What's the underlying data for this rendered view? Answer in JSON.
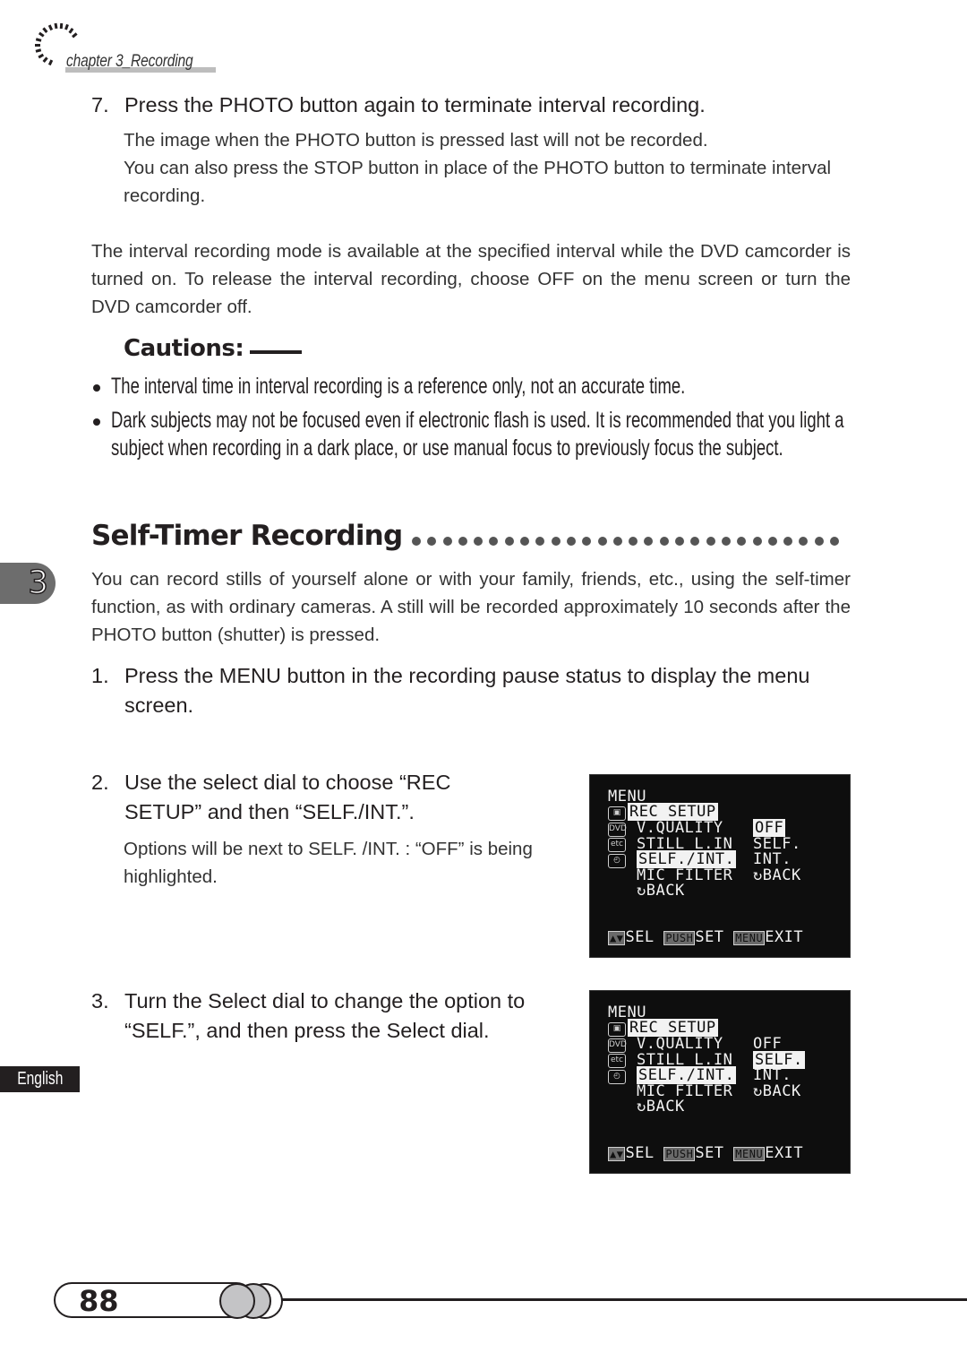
{
  "header": {
    "chapter_label": "chapter 3_Recording"
  },
  "step7": {
    "number": "7.",
    "heading": "Press the PHOTO button again to terminate interval recording.",
    "lines": [
      "The image when the PHOTO button is pressed last will not be recorded.",
      "You can also press the STOP button in place of the PHOTO button to terminate interval recording."
    ]
  },
  "interval_note": "The interval recording mode is available at the specified interval while the DVD camcorder is turned on. To release the interval recording, choose OFF on the menu screen or turn the DVD camcorder off.",
  "cautions": {
    "title": "Cautions:",
    "items": [
      "The interval time in interval recording is a reference only, not an accurate time.",
      "Dark subjects may not be focused even if electronic flash is used. It is recommended that you light a",
      "subject when recording in a dark place, or use manual focus to previously focus the subject."
    ]
  },
  "section": {
    "title": "Self-Timer Recording",
    "intro": "You can record stills of yourself alone or with your family, friends, etc., using the self-timer function, as with ordinary cameras. A still will be recorded approximately 10 seconds after the PHOTO button (shutter) is pressed."
  },
  "chapter_tab": "3",
  "language_tab": "English",
  "steps": [
    {
      "number": "1.",
      "heading": "Press the MENU button in the recording pause status to display the menu screen."
    },
    {
      "number": "2.",
      "heading": "Use the select dial to choose “REC SETUP” and then “SELF./INT.”.",
      "body": "Options will be next to SELF. /INT. : “OFF” is being highlighted."
    },
    {
      "number": "3.",
      "heading": "Turn the Select dial to change the option to “SELF.”, and then press the Select dial."
    }
  ],
  "menu_screens": [
    {
      "title": "MENU",
      "category": "REC SETUP",
      "icons": [
        "camera-icon",
        "dvd-icon",
        "etc-icon",
        "clock-icon"
      ],
      "icon_labels": [
        "▣",
        "DVD",
        "etc",
        "◴"
      ],
      "items": [
        "V.QUALITY",
        "STILL L.IN",
        "SELF./INT.",
        "MIC FILTER",
        "↻BACK"
      ],
      "options": [
        "OFF",
        "SELF.",
        "INT.",
        "↻BACK"
      ],
      "highlighted_option": "OFF",
      "footer": {
        "sel_key": "▲▼",
        "sel": "SEL",
        "push_key": "PUSH",
        "set": "SET",
        "menu_key": "MENU",
        "exit": "EXIT"
      }
    },
    {
      "title": "MENU",
      "category": "REC SETUP",
      "icons": [
        "camera-icon",
        "dvd-icon",
        "etc-icon",
        "clock-icon"
      ],
      "icon_labels": [
        "▣",
        "DVD",
        "etc",
        "◴"
      ],
      "items": [
        "V.QUALITY",
        "STILL L.IN",
        "SELF./INT.",
        "MIC FILTER",
        "↻BACK"
      ],
      "options": [
        "OFF",
        "SELF.",
        "INT.",
        "↻BACK"
      ],
      "highlighted_option": "SELF.",
      "footer": {
        "sel_key": "▲▼",
        "sel": "SEL",
        "push_key": "PUSH",
        "set": "SET",
        "menu_key": "MENU",
        "exit": "EXIT"
      }
    }
  ],
  "footer": {
    "page_number": "88"
  }
}
